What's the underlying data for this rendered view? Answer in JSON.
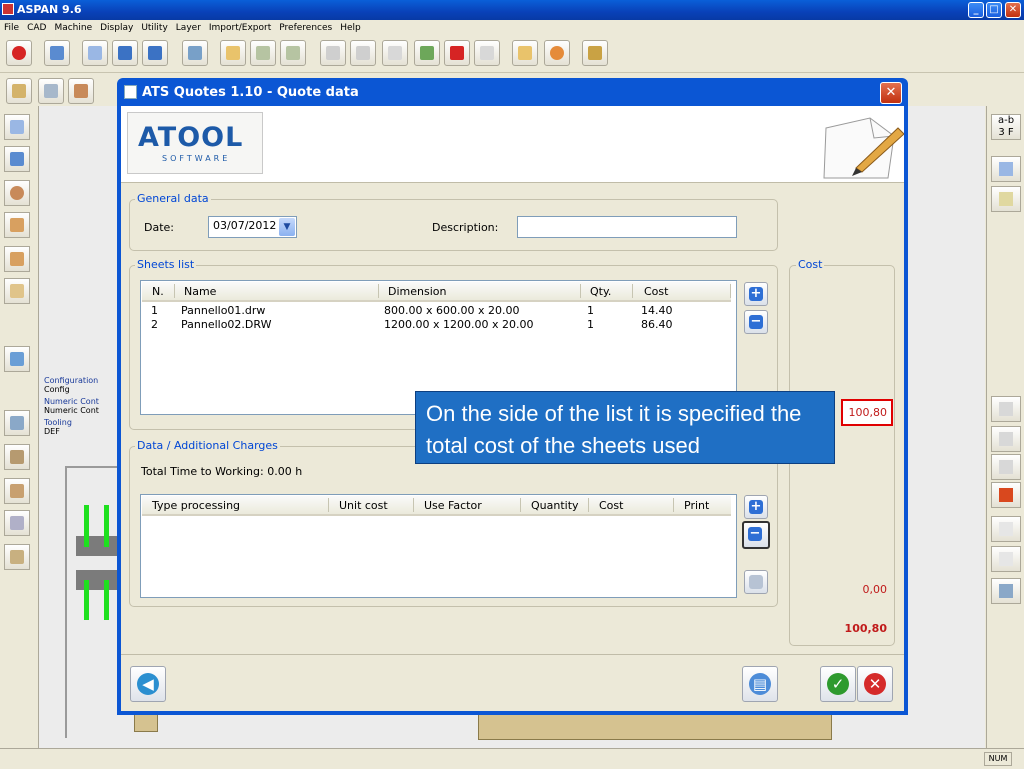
{
  "app": {
    "title": "ASPAN 9.6"
  },
  "menu": [
    "File",
    "CAD",
    "Machine",
    "Display",
    "Utility",
    "Layer",
    "Import/Export",
    "Preferences",
    "Help"
  ],
  "tree": {
    "items": [
      {
        "label": "Configuration",
        "value": "Config"
      },
      {
        "label": "Numeric Cont",
        "value": "Numeric Cont"
      },
      {
        "label": "Tooling",
        "value": "DEF"
      }
    ]
  },
  "dialog": {
    "title": "ATS Quotes 1.10 - Quote data",
    "logo_main": "ATOOL",
    "logo_sub": "SOFTWARE",
    "general": {
      "label": "General data",
      "date_label": "Date:",
      "date_value": "03/07/2012",
      "desc_label": "Description:",
      "desc_value": ""
    },
    "sheets": {
      "label": "Sheets list",
      "columns": [
        "N.",
        "Name",
        "Dimension",
        "Qty.",
        "Cost"
      ],
      "rows": [
        {
          "n": "1",
          "name": "Pannello01.drw",
          "dim": "800.00 x 600.00 x 20.00",
          "qty": "1",
          "cost": "14.40"
        },
        {
          "n": "2",
          "name": "Pannello02.DRW",
          "dim": "1200.00 x 1200.00 x 20.00",
          "qty": "1",
          "cost": "86.40"
        }
      ]
    },
    "charges": {
      "label": "Data / Additional Charges",
      "total_time": "Total Time to Working: 0.00 h",
      "columns": [
        "Type processing",
        "Unit cost",
        "Use Factor",
        "Quantity",
        "Cost",
        "Print"
      ]
    },
    "cost": {
      "label": "Cost",
      "sheets_total": "100,80",
      "charges_total": "0,00",
      "grand_total": "100,80"
    }
  },
  "callout": {
    "text": "On the side of the list it is specified the total cost of the sheets used"
  },
  "status": {
    "num": "NUM"
  },
  "colors": {
    "dialog_frame": "#0b56d4",
    "group_label": "#0046d5",
    "callout_bg": "#1f6fc4",
    "cost_text": "#c01a1a",
    "highlight_border": "#e00000"
  }
}
